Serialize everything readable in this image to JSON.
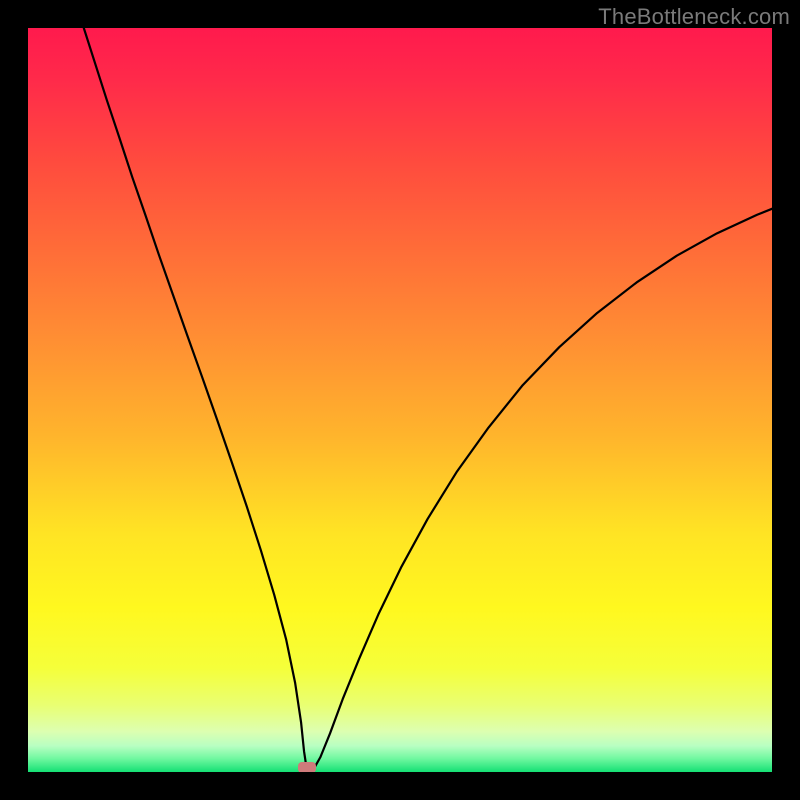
{
  "watermark": "TheBottleneck.com",
  "chart_data": {
    "type": "line",
    "title": "",
    "xlabel": "",
    "ylabel": "",
    "xlim": [
      0,
      1
    ],
    "ylim": [
      0,
      1
    ],
    "background_gradient": {
      "stops": [
        {
          "offset": 0.0,
          "color": "#ff1a4d"
        },
        {
          "offset": 0.07,
          "color": "#ff2a4a"
        },
        {
          "offset": 0.18,
          "color": "#ff4b3e"
        },
        {
          "offset": 0.3,
          "color": "#ff6d38"
        },
        {
          "offset": 0.42,
          "color": "#ff8f33"
        },
        {
          "offset": 0.55,
          "color": "#ffb52c"
        },
        {
          "offset": 0.68,
          "color": "#ffe424"
        },
        {
          "offset": 0.78,
          "color": "#fff81f"
        },
        {
          "offset": 0.86,
          "color": "#f5ff3a"
        },
        {
          "offset": 0.91,
          "color": "#e9ff72"
        },
        {
          "offset": 0.945,
          "color": "#ddffb0"
        },
        {
          "offset": 0.965,
          "color": "#b8ffc2"
        },
        {
          "offset": 0.982,
          "color": "#70f8a0"
        },
        {
          "offset": 1.0,
          "color": "#14e074"
        }
      ]
    },
    "minimum_marker": {
      "x": 0.375,
      "y": 0.0,
      "color": "#cf7b7b"
    },
    "curve": {
      "description": "Two branches of a smooth curve meeting at a minimum; left branch enters from top-left, right branch exits mid-right edge.",
      "points": [
        {
          "x": 0.075,
          "y": 1.0
        },
        {
          "x": 0.09,
          "y": 0.953
        },
        {
          "x": 0.106,
          "y": 0.903
        },
        {
          "x": 0.123,
          "y": 0.852
        },
        {
          "x": 0.14,
          "y": 0.8
        },
        {
          "x": 0.158,
          "y": 0.748
        },
        {
          "x": 0.176,
          "y": 0.695
        },
        {
          "x": 0.195,
          "y": 0.641
        },
        {
          "x": 0.214,
          "y": 0.587
        },
        {
          "x": 0.234,
          "y": 0.531
        },
        {
          "x": 0.254,
          "y": 0.474
        },
        {
          "x": 0.274,
          "y": 0.416
        },
        {
          "x": 0.294,
          "y": 0.357
        },
        {
          "x": 0.313,
          "y": 0.298
        },
        {
          "x": 0.331,
          "y": 0.238
        },
        {
          "x": 0.347,
          "y": 0.178
        },
        {
          "x": 0.359,
          "y": 0.12
        },
        {
          "x": 0.367,
          "y": 0.067
        },
        {
          "x": 0.371,
          "y": 0.028
        },
        {
          "x": 0.374,
          "y": 0.008
        },
        {
          "x": 0.378,
          "y": 0.0
        },
        {
          "x": 0.384,
          "y": 0.004
        },
        {
          "x": 0.393,
          "y": 0.02
        },
        {
          "x": 0.406,
          "y": 0.052
        },
        {
          "x": 0.423,
          "y": 0.098
        },
        {
          "x": 0.445,
          "y": 0.152
        },
        {
          "x": 0.471,
          "y": 0.212
        },
        {
          "x": 0.502,
          "y": 0.276
        },
        {
          "x": 0.537,
          "y": 0.34
        },
        {
          "x": 0.576,
          "y": 0.403
        },
        {
          "x": 0.619,
          "y": 0.463
        },
        {
          "x": 0.665,
          "y": 0.52
        },
        {
          "x": 0.714,
          "y": 0.571
        },
        {
          "x": 0.765,
          "y": 0.617
        },
        {
          "x": 0.818,
          "y": 0.658
        },
        {
          "x": 0.872,
          "y": 0.694
        },
        {
          "x": 0.926,
          "y": 0.724
        },
        {
          "x": 0.98,
          "y": 0.749
        },
        {
          "x": 1.0,
          "y": 0.757
        }
      ]
    }
  }
}
